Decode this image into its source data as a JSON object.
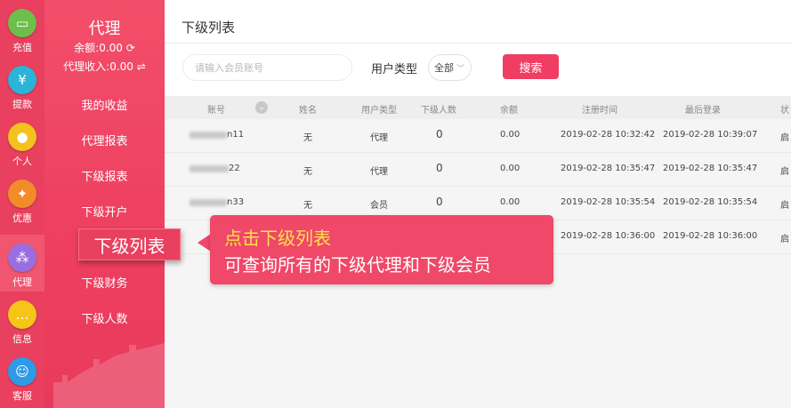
{
  "rail": [
    {
      "name": "recharge",
      "label": "充值",
      "icon": "wallet-icon",
      "glyph": "▭",
      "color": "#6cc04a"
    },
    {
      "name": "withdraw",
      "label": "提款",
      "icon": "money-bag-icon",
      "glyph": "¥",
      "color": "#2ab4d8"
    },
    {
      "name": "personal",
      "label": "个人",
      "icon": "user-icon",
      "glyph": "●",
      "color": "#f4c21e"
    },
    {
      "name": "promo",
      "label": "优惠",
      "icon": "ticket-icon",
      "glyph": "✦",
      "color": "#f28b2a"
    },
    {
      "name": "agent",
      "label": "代理",
      "icon": "network-icon",
      "glyph": "⁂",
      "color": "#9a6ee0"
    },
    {
      "name": "message",
      "label": "信息",
      "icon": "chat-icon",
      "glyph": "…",
      "color": "#f5c518"
    },
    {
      "name": "support",
      "label": "客服",
      "icon": "headset-icon",
      "glyph": "☺",
      "color": "#2e9be6"
    }
  ],
  "sidebar": {
    "title": "代理",
    "balance": "余额:0.00 ⟳",
    "income": "代理收入:0.00 ⇌",
    "menu": [
      "我的收益",
      "代理报表",
      "下级报表",
      "下级开户",
      "下级列表",
      "下级财务",
      "下级人数"
    ]
  },
  "panel": {
    "title": "下级列表",
    "search_placeholder": "请输入会员账号",
    "type_label": "用户类型",
    "type_value": "全部",
    "search_button": "搜索"
  },
  "table": {
    "headers": [
      "账号",
      "姓名",
      "用户类型",
      "下级人数",
      "余额",
      "注册时间",
      "最后登录",
      "状"
    ],
    "rows": [
      {
        "account": "n11",
        "name": "无",
        "type": "代理",
        "subs": "0",
        "balance": "0.00",
        "registered": "2019-02-28 10:32:42",
        "last_login": "2019-02-28 10:39:07",
        "status": "启"
      },
      {
        "account": "22",
        "name": "无",
        "type": "代理",
        "subs": "0",
        "balance": "0.00",
        "registered": "2019-02-28 10:35:47",
        "last_login": "2019-02-28 10:35:47",
        "status": "启"
      },
      {
        "account": "n33",
        "name": "无",
        "type": "会员",
        "subs": "0",
        "balance": "0.00",
        "registered": "2019-02-28 10:35:54",
        "last_login": "2019-02-28 10:35:54",
        "status": "启"
      },
      {
        "account": "",
        "name": "",
        "type": "",
        "subs": "",
        "balance": "",
        "registered": "2019-02-28 10:36:00",
        "last_login": "2019-02-28 10:36:00",
        "status": "启"
      }
    ]
  },
  "callout": {
    "tag": "下级列表",
    "line1": "点击下级列表",
    "line2": "可查询所有的下级代理和下级会员"
  },
  "colors": {
    "brand": "#e8405e",
    "button": "#ef3d63",
    "highlight": "#ffe24a"
  }
}
